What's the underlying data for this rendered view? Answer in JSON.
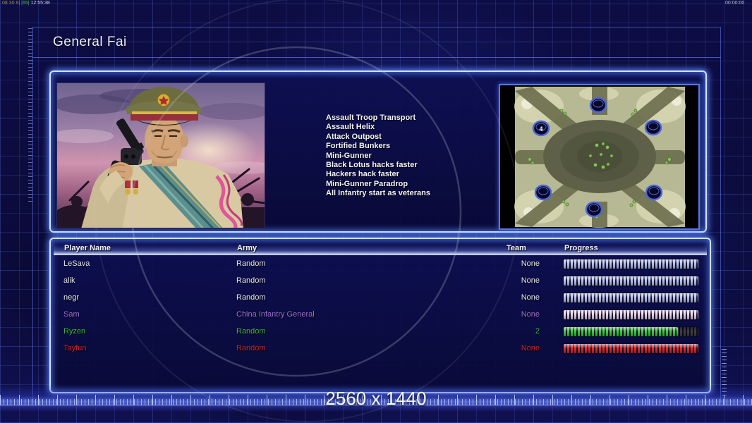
{
  "hud": {
    "debug_left_segments": [
      {
        "text": "08 30 9| ",
        "color": "#9a8a48"
      },
      {
        "text": "|65| ",
        "color": "#57aa57"
      },
      {
        "text": "12:55:38",
        "color": "#c9cdda"
      }
    ],
    "timer_right": "00:00:00",
    "resolution_label": "2560 x 1440"
  },
  "header": {
    "title": "General Fai"
  },
  "general": {
    "abilities": [
      "Assault Troop Transport",
      "Assault Helix",
      "Attack Outpost",
      "Fortified Bunkers",
      "Mini-Gunner",
      "Black Lotus hacks faster",
      "Hackers hack faster",
      "Mini-Gunner Paradrop",
      "All Infantry start as veterans"
    ]
  },
  "map_preview": {
    "start_position_label": "4"
  },
  "players": {
    "columns": [
      "Player Name",
      "Army",
      "Team",
      "Progress"
    ],
    "rows": [
      {
        "name": "LeSava",
        "army": "Random",
        "team": "None",
        "color": "#e6e6ec",
        "bar_color": "#b6c0f0",
        "progress": 100
      },
      {
        "name": "alik",
        "army": "Random",
        "team": "None",
        "color": "#e6e6ec",
        "bar_color": "#b6c0f0",
        "progress": 100
      },
      {
        "name": "negr",
        "army": "Random",
        "team": "None",
        "color": "#e6e6ec",
        "bar_color": "#b6c0f0",
        "progress": 100
      },
      {
        "name": "Sam",
        "army": "China Infantry General",
        "team": "None",
        "color": "#a06fd2",
        "bar_color": "#ecd4ea",
        "progress": 100
      },
      {
        "name": "Ryzen",
        "army": "Random",
        "team": "2",
        "color": "#3cb83c",
        "bar_color": "#31cd31",
        "progress": 85
      },
      {
        "name": "Tayfun",
        "army": "Random",
        "team": "None",
        "color": "#d02020",
        "bar_color": "#e22222",
        "progress": 100
      }
    ]
  }
}
